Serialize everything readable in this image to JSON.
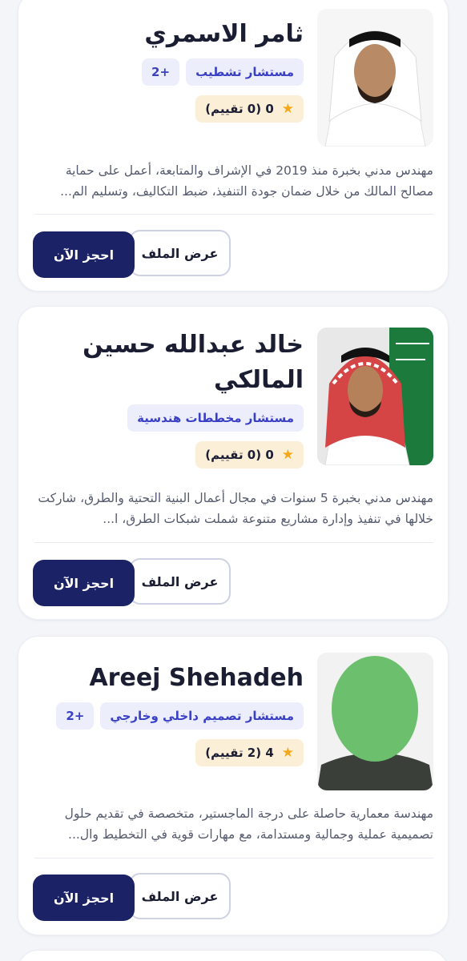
{
  "consultants": [
    {
      "name": "ثامر الاسمري",
      "tags": [
        "مستشار تشطيب",
        "+2"
      ],
      "rating": "0 (0 تقييم)",
      "description": "مهندس مدني بخبرة منذ 2019 في الإشراف والمتابعة، أعمل على حماية مصالح المالك من خلال ضمان جودة التنفيذ، ضبط التكاليف، وتسليم الم...",
      "profile_button": "عرض الملف",
      "book_button": "احجز الآن"
    },
    {
      "name": "خالد عبدالله حسين المالكي",
      "tags": [
        "مستشار مخططات هندسية"
      ],
      "rating": "0 (0 تقييم)",
      "description": "مهندس مدني بخبرة 5 سنوات في مجال أعمال البنية التحتية والطرق، شاركت خلالها في تنفيذ وإدارة مشاريع متنوعة شملت شبكات الطرق، ا...",
      "profile_button": "عرض الملف",
      "book_button": "احجز الآن"
    },
    {
      "name": "Areej Shehadeh",
      "tags": [
        "مستشار تصميم داخلي وخارجي",
        "+2"
      ],
      "rating": "4 (2 تقييم)",
      "description": "مهندسة معمارية حاصلة على درجة الماجستير، متخصصة في تقديم حلول تصميمية عملية وجمالية ومستدامة، مع مهارات قوية في التخطيط وال...",
      "profile_button": "عرض الملف",
      "book_button": "احجز الآن"
    }
  ],
  "colors": {
    "primary": "#1c2266",
    "tag_bg": "#eceefb",
    "tag_text": "#3a40c4",
    "rating_bg": "#fbf0d7",
    "star": "#f3a81b"
  },
  "icons": [
    "star-icon"
  ]
}
